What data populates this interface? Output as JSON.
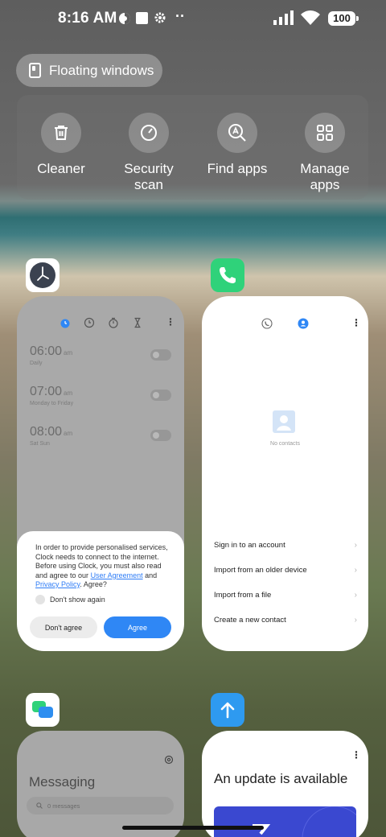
{
  "status_bar": {
    "time": "8:16 AM",
    "battery": "100",
    "dots": "··"
  },
  "floating_windows": {
    "label": "Floating windows",
    "icon": "floating-window-icon"
  },
  "quick_actions": [
    {
      "label": "Cleaner",
      "icon": "trash-icon"
    },
    {
      "label": "Security\nscan",
      "icon": "security-scan-icon"
    },
    {
      "label": "Find apps",
      "icon": "find-apps-icon"
    },
    {
      "label": "Manage\napps",
      "icon": "grid-icon"
    }
  ],
  "clock_card": {
    "app_icon": "clock-app-icon",
    "alarms": [
      {
        "time": "06:00",
        "ampm": "am",
        "sub": "Daily"
      },
      {
        "time": "07:00",
        "ampm": "am",
        "sub": "Monday to Friday"
      },
      {
        "time": "08:00",
        "ampm": "am",
        "sub": "Sat Sun"
      }
    ],
    "dialog": {
      "text_before": "In order to provide personalised services, Clock needs to connect to the internet. Before using Clock, you must also read and agree to our ",
      "link_user_agreement": "User Agreement",
      "text_and": " and ",
      "link_privacy_policy": "Privacy Policy",
      "text_after": ". Agree?",
      "dont_show_again": "Don't show again",
      "disagree": "Don't agree",
      "agree": "Agree"
    }
  },
  "contacts_card": {
    "app_icon": "phone-app-icon",
    "empty_text": "No contacts",
    "options": [
      "Sign in to an account",
      "Import from an older device",
      "Import from a file",
      "Create a new contact"
    ]
  },
  "messaging_card": {
    "app_icon": "messaging-app-icon",
    "title": "Messaging",
    "search_placeholder": "0 messages"
  },
  "update_card": {
    "app_icon": "updater-app-icon",
    "title": "An update is available"
  },
  "colors": {
    "accent_blue": "#2f87f5",
    "phone_green": "#2fd27a",
    "update_blue": "#3a48d0"
  }
}
